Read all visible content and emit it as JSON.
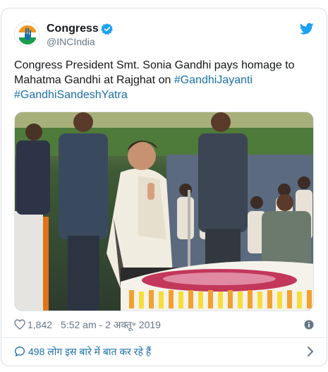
{
  "account": {
    "display_name": "Congress",
    "handle": "@INCIndia",
    "verified": true,
    "avatar_icon": "congress-hand-logo",
    "brand_colors": {
      "saffron": "#f7941d",
      "green": "#1a9e4b",
      "blue": "#1b6fa8"
    }
  },
  "tweet": {
    "text": "Congress President Smt. Sonia Gandhi pays homage to Mahatma Gandhi at Rajghat on ",
    "hashtags": [
      "#GandhiJayanti",
      "#GandhiSandeshYatra"
    ]
  },
  "meta": {
    "likes": "1,842",
    "time": "5:52 am - 2 अक्तू॰ 2019"
  },
  "footer": {
    "discussion": "498 लोग इस बारे में बात कर रहे हैं"
  },
  "icons": {
    "platform": "twitter-bird-icon",
    "like": "heart-icon",
    "info": "info-icon",
    "reply": "speech-bubble-icon",
    "more": "chevron-right-icon"
  }
}
